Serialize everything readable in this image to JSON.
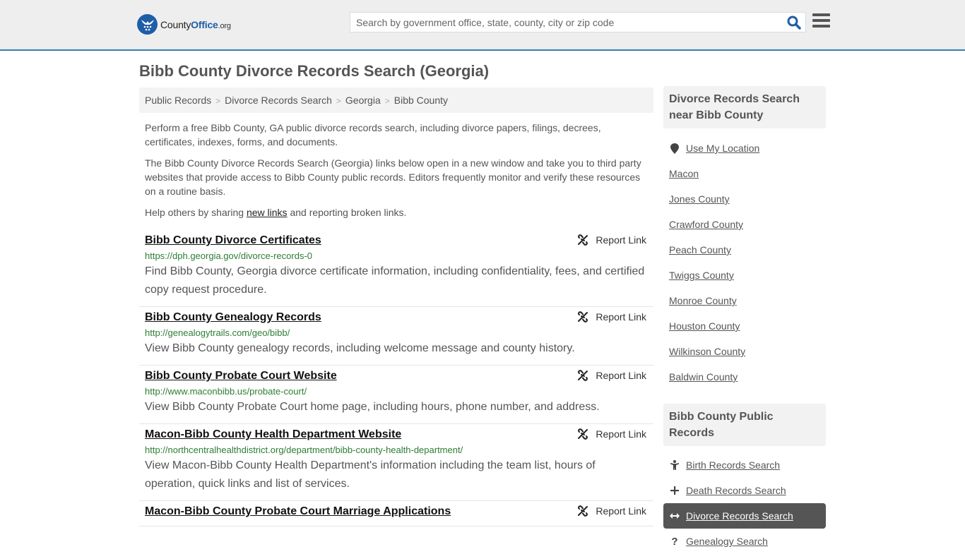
{
  "header": {
    "logo": {
      "name_part1": "County",
      "name_part2": "Office",
      "name_suffix": ".org"
    },
    "search": {
      "placeholder": "Search by government office, state, county, city or zip code",
      "value": ""
    }
  },
  "page": {
    "title": "Bibb County Divorce Records Search (Georgia)",
    "breadcrumb": [
      "Public Records",
      "Divorce Records Search",
      "Georgia",
      "Bibb County"
    ],
    "intro": [
      "Perform a free Bibb County, GA public divorce records search, including divorce papers, filings, decrees, certificates, indexes, forms, and documents.",
      "The Bibb County Divorce Records Search (Georgia) links below open in a new window and take you to third party websites that provide access to Bibb County public records. Editors frequently monitor and verify these resources on a routine basis."
    ],
    "help": {
      "before": "Help others by sharing ",
      "link": "new links",
      "after": " and reporting broken links."
    }
  },
  "report_label": "Report Link",
  "results": [
    {
      "title": "Bibb County Divorce Certificates",
      "url": "https://dph.georgia.gov/divorce-records-0",
      "desc": "Find Bibb County, Georgia divorce certificate information, including confidentiality, fees, and certified copy request procedure."
    },
    {
      "title": "Bibb County Genealogy Records",
      "url": "http://genealogytrails.com/geo/bibb/",
      "desc": "View Bibb County genealogy records, including welcome message and county history."
    },
    {
      "title": "Bibb County Probate Court Website",
      "url": "http://www.maconbibb.us/probate-court/",
      "desc": "View Bibb County Probate Court home page, including hours, phone number, and address."
    },
    {
      "title": "Macon-Bibb County Health Department Website",
      "url": "http://northcentralhealthdistrict.org/department/bibb-county-health-department/",
      "desc": "View Macon-Bibb County Health Department's information including the team list, hours of operation, quick links and list of services."
    },
    {
      "title": "Macon-Bibb County Probate Court Marriage Applications",
      "url": "",
      "desc": ""
    }
  ],
  "sidebar": {
    "nearby": {
      "heading": "Divorce Records Search near Bibb County",
      "use_location": "Use My Location",
      "items": [
        "Macon",
        "Jones County",
        "Crawford County",
        "Peach County",
        "Twiggs County",
        "Monroe County",
        "Houston County",
        "Wilkinson County",
        "Baldwin County"
      ]
    },
    "public_records": {
      "heading": "Bibb County Public Records",
      "items": [
        {
          "label": "Birth Records Search",
          "icon": "child-icon",
          "active": false
        },
        {
          "label": "Death Records Search",
          "icon": "cross-icon",
          "active": false
        },
        {
          "label": "Divorce Records Search",
          "icon": "arrows-horizontal-icon",
          "active": true
        },
        {
          "label": "Genealogy Search",
          "icon": "question-icon",
          "active": false
        }
      ]
    }
  },
  "colors": {
    "brand": "#1e5ea8",
    "header_border": "#3d7fae",
    "url_green": "#2e7d32",
    "active_bg": "#555555"
  }
}
